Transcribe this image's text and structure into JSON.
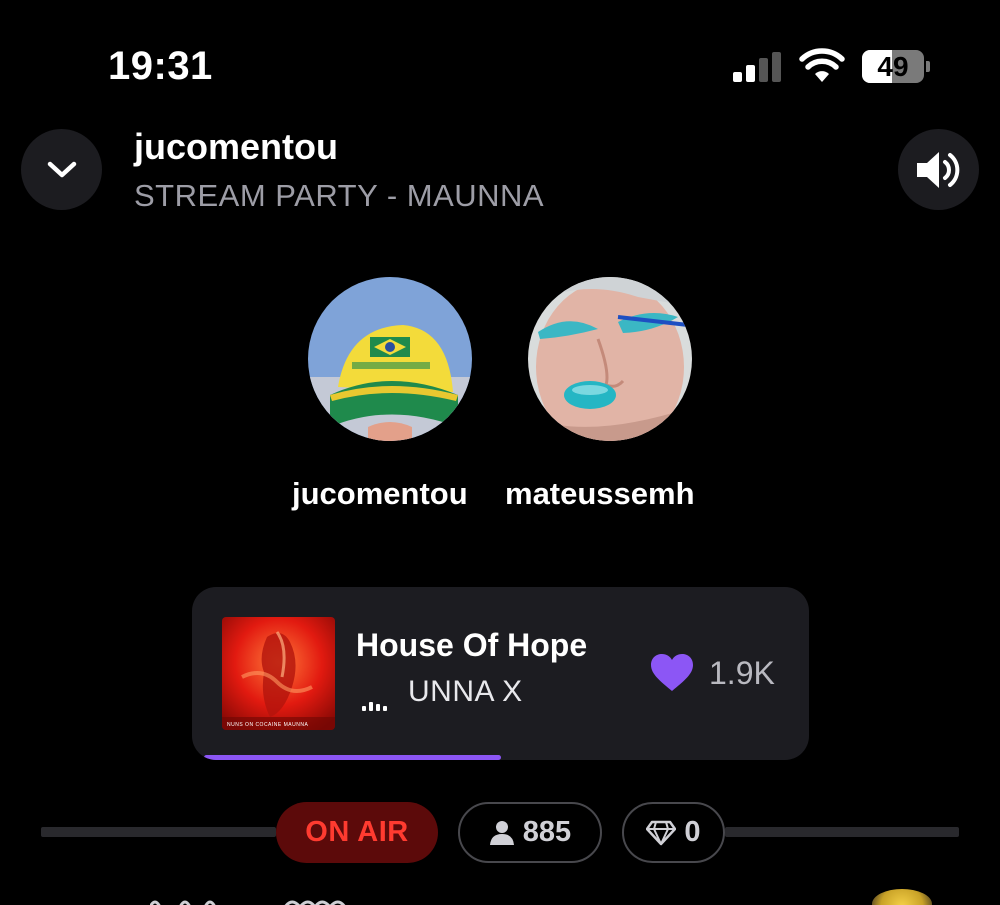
{
  "status_bar": {
    "time": "19:31",
    "battery_percent": "49",
    "battery_level": 0.49,
    "signal_bars_active": 2,
    "signal_bars_total": 4
  },
  "header": {
    "title": "jucomentou",
    "subtitle": "STREAM PARTY - MAUNNA",
    "collapse_icon": "chevron-down-icon",
    "volume_icon": "speaker-volume-icon"
  },
  "participants": [
    {
      "name": "jucomentou"
    },
    {
      "name": "mateussemh"
    }
  ],
  "now_playing": {
    "title": "House Of Hope",
    "artist": "UNNA X",
    "likes": "1.9K",
    "progress": 0.5,
    "heart_color": "#8c56f5",
    "cover_text": "NUNS ON COCAINE MAUNNA"
  },
  "stats": {
    "on_air_label": "ON AIR",
    "listeners": "885",
    "gems": "0",
    "listeners_icon": "person-icon",
    "gems_icon": "diamond-icon"
  },
  "colors": {
    "accent": "#8c56f5",
    "on_air_text": "#ff3b30",
    "on_air_bg": "#5c0a0a",
    "card_bg": "#1c1c21"
  }
}
